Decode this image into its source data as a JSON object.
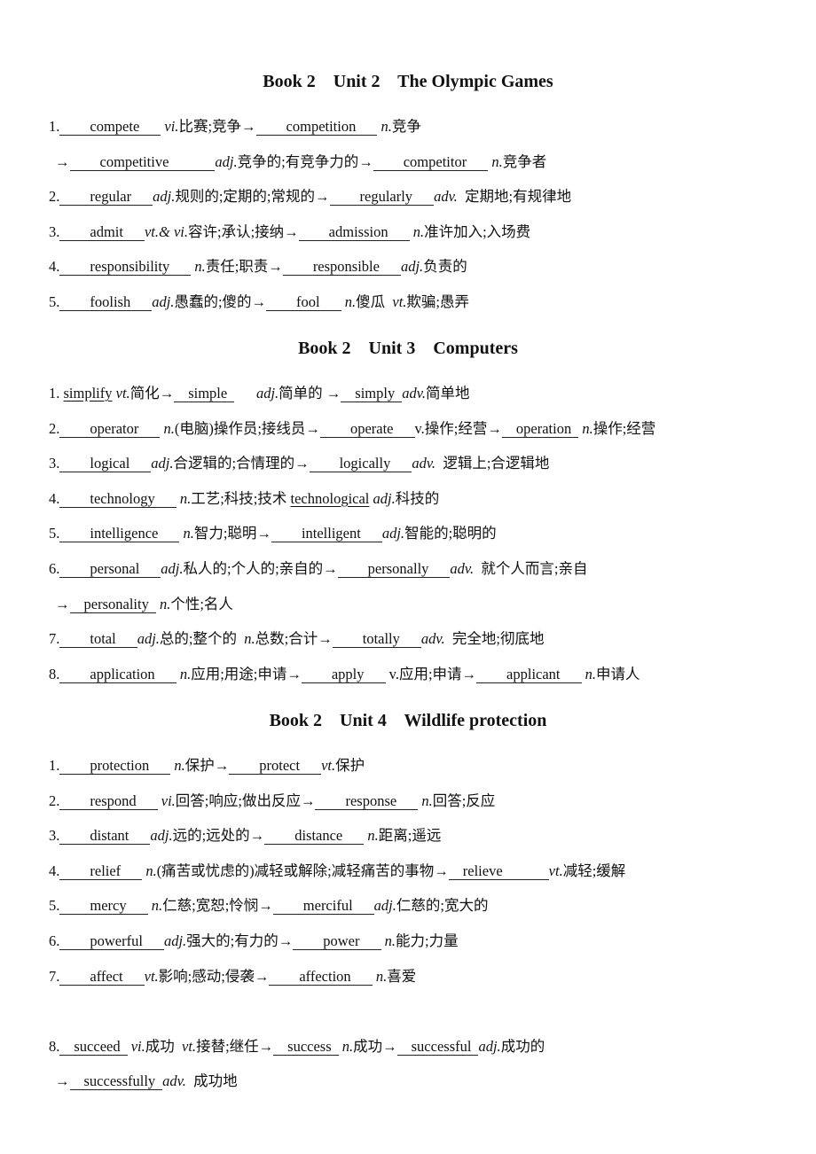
{
  "sections": [
    {
      "title": "Book 2    Unit 2    The Olympic Games",
      "lines": [
        {
          "segs": [
            {
              "t": "text",
              "v": "1."
            },
            {
              "t": "blank",
              "v": "compete"
            },
            {
              "t": "text",
              "v": " "
            },
            {
              "t": "pos",
              "v": "vi."
            },
            {
              "t": "text",
              "v": "比赛;竞争→"
            },
            {
              "t": "blank",
              "v": "competition"
            },
            {
              "t": "text",
              "v": " "
            },
            {
              "t": "pos",
              "v": "n."
            },
            {
              "t": "text",
              "v": "竞争"
            }
          ]
        },
        {
          "indent": true,
          "segs": [
            {
              "t": "text",
              "v": "→"
            },
            {
              "t": "blank",
              "cls": "wide",
              "v": "competitive"
            },
            {
              "t": "pos",
              "v": "adj."
            },
            {
              "t": "text",
              "v": "竞争的;有竞争力的→"
            },
            {
              "t": "blank",
              "v": "competitor"
            },
            {
              "t": "text",
              "v": " "
            },
            {
              "t": "pos",
              "v": "n."
            },
            {
              "t": "text",
              "v": "竞争者"
            }
          ]
        },
        {
          "segs": [
            {
              "t": "text",
              "v": "2."
            },
            {
              "t": "blank",
              "v": "regular"
            },
            {
              "t": "pos",
              "v": "adj."
            },
            {
              "t": "text",
              "v": "规则的;定期的;常规的→"
            },
            {
              "t": "blank",
              "v": "regularly"
            },
            {
              "t": "pos",
              "v": "adv."
            },
            {
              "t": "text",
              "v": "  定期地;有规律地"
            }
          ]
        },
        {
          "segs": [
            {
              "t": "text",
              "v": "3."
            },
            {
              "t": "blank",
              "v": "admit"
            },
            {
              "t": "pos",
              "v": "vt.& vi."
            },
            {
              "t": "text",
              "v": "容许;承认;接纳→"
            },
            {
              "t": "blank",
              "v": "admission"
            },
            {
              "t": "text",
              "v": " "
            },
            {
              "t": "pos",
              "v": "n."
            },
            {
              "t": "text",
              "v": "准许加入;入场费"
            }
          ]
        },
        {
          "segs": [
            {
              "t": "text",
              "v": "4."
            },
            {
              "t": "blank",
              "v": "responsibility"
            },
            {
              "t": "text",
              "v": " "
            },
            {
              "t": "pos",
              "v": "n."
            },
            {
              "t": "text",
              "v": "责任;职责→"
            },
            {
              "t": "blank",
              "v": "responsible"
            },
            {
              "t": "pos",
              "v": "adj."
            },
            {
              "t": "text",
              "v": "负责的"
            }
          ]
        },
        {
          "segs": [
            {
              "t": "text",
              "v": "5."
            },
            {
              "t": "blank",
              "v": "foolish"
            },
            {
              "t": "pos",
              "v": "adj."
            },
            {
              "t": "text",
              "v": "愚蠢的;傻的→"
            },
            {
              "t": "blank",
              "v": "fool"
            },
            {
              "t": "text",
              "v": " "
            },
            {
              "t": "pos",
              "v": "n."
            },
            {
              "t": "text",
              "v": "傻瓜  "
            },
            {
              "t": "pos",
              "v": "vt."
            },
            {
              "t": "text",
              "v": "欺骗;愚弄"
            }
          ]
        }
      ]
    },
    {
      "title": "Book 2    Unit 3    Computers",
      "lines": [
        {
          "segs": [
            {
              "t": "text",
              "v": "1. "
            },
            {
              "t": "u",
              "v": "simplify"
            },
            {
              "t": "text",
              "v": " "
            },
            {
              "t": "pos",
              "v": "vt."
            },
            {
              "t": "text",
              "v": "简化→"
            },
            {
              "t": "blank",
              "cls": "tight",
              "v": "simple"
            },
            {
              "t": "text",
              "v": "      "
            },
            {
              "t": "pos",
              "v": "adj."
            },
            {
              "t": "text",
              "v": "简单的 →"
            },
            {
              "t": "blank",
              "cls": "tight",
              "v": "simply"
            },
            {
              "t": "pos",
              "v": "adv."
            },
            {
              "t": "text",
              "v": "简单地"
            }
          ]
        },
        {
          "segs": [
            {
              "t": "text",
              "v": "2."
            },
            {
              "t": "blank",
              "v": "operator"
            },
            {
              "t": "text",
              "v": " "
            },
            {
              "t": "pos",
              "v": "n."
            },
            {
              "t": "text",
              "v": "(电脑)操作员;接线员→"
            },
            {
              "t": "blank",
              "v": "operate"
            },
            {
              "t": "text",
              "v": "v.操作;经营→"
            },
            {
              "t": "blank",
              "cls": "tight",
              "v": "operation"
            },
            {
              "t": "text",
              "v": " "
            },
            {
              "t": "pos",
              "v": "n."
            },
            {
              "t": "text",
              "v": "操作;经营"
            }
          ]
        },
        {
          "segs": [
            {
              "t": "text",
              "v": "3."
            },
            {
              "t": "blank",
              "v": "logical"
            },
            {
              "t": "pos",
              "v": "adj."
            },
            {
              "t": "text",
              "v": "合逻辑的;合情理的→"
            },
            {
              "t": "blank",
              "v": "logically"
            },
            {
              "t": "pos",
              "v": "adv."
            },
            {
              "t": "text",
              "v": "  逻辑上;合逻辑地"
            }
          ]
        },
        {
          "segs": [
            {
              "t": "text",
              "v": "4."
            },
            {
              "t": "blank",
              "v": "technology"
            },
            {
              "t": "text",
              "v": " "
            },
            {
              "t": "pos",
              "v": "n."
            },
            {
              "t": "text",
              "v": "工艺;科技;技术 "
            },
            {
              "t": "u",
              "v": "technological"
            },
            {
              "t": "text",
              "v": " "
            },
            {
              "t": "pos",
              "v": "adj."
            },
            {
              "t": "text",
              "v": "科技的"
            }
          ]
        },
        {
          "segs": [
            {
              "t": "text",
              "v": "5."
            },
            {
              "t": "blank",
              "v": "intelligence"
            },
            {
              "t": "text",
              "v": " "
            },
            {
              "t": "pos",
              "v": "n."
            },
            {
              "t": "text",
              "v": "智力;聪明→"
            },
            {
              "t": "blank",
              "v": "intelligent"
            },
            {
              "t": "pos",
              "v": "adj."
            },
            {
              "t": "text",
              "v": "智能的;聪明的"
            }
          ]
        },
        {
          "segs": [
            {
              "t": "text",
              "v": "6."
            },
            {
              "t": "blank",
              "v": "personal"
            },
            {
              "t": "pos",
              "v": "adj."
            },
            {
              "t": "text",
              "v": "私人的;个人的;亲自的→"
            },
            {
              "t": "blank",
              "v": "personally"
            },
            {
              "t": "pos",
              "v": "adv."
            },
            {
              "t": "text",
              "v": "  就个人而言;亲自"
            }
          ]
        },
        {
          "indent": true,
          "segs": [
            {
              "t": "text",
              "v": "→"
            },
            {
              "t": "blank",
              "cls": "tight",
              "v": "personality"
            },
            {
              "t": "text",
              "v": " "
            },
            {
              "t": "pos",
              "v": "n."
            },
            {
              "t": "text",
              "v": "个性;名人"
            }
          ]
        },
        {
          "segs": [
            {
              "t": "text",
              "v": "7."
            },
            {
              "t": "blank",
              "v": "total"
            },
            {
              "t": "pos",
              "v": "adj."
            },
            {
              "t": "text",
              "v": "总的;整个的  "
            },
            {
              "t": "pos",
              "v": "n."
            },
            {
              "t": "text",
              "v": "总数;合计→"
            },
            {
              "t": "blank",
              "v": "totally"
            },
            {
              "t": "pos",
              "v": "adv."
            },
            {
              "t": "text",
              "v": "  完全地;彻底地"
            }
          ]
        },
        {
          "segs": [
            {
              "t": "text",
              "v": "8."
            },
            {
              "t": "blank",
              "v": "application"
            },
            {
              "t": "text",
              "v": " "
            },
            {
              "t": "pos",
              "v": "n."
            },
            {
              "t": "text",
              "v": "应用;用途;申请→"
            },
            {
              "t": "blank",
              "v": "apply"
            },
            {
              "t": "text",
              "v": " v.应用;申请→"
            },
            {
              "t": "blank",
              "v": "applicant"
            },
            {
              "t": "text",
              "v": " "
            },
            {
              "t": "pos",
              "v": "n."
            },
            {
              "t": "text",
              "v": "申请人"
            }
          ]
        }
      ]
    },
    {
      "title": "Book 2    Unit 4    Wildlife protection",
      "lines": [
        {
          "segs": [
            {
              "t": "text",
              "v": "1."
            },
            {
              "t": "blank",
              "v": "protection"
            },
            {
              "t": "text",
              "v": " "
            },
            {
              "t": "pos",
              "v": "n."
            },
            {
              "t": "text",
              "v": "保护→"
            },
            {
              "t": "blank",
              "v": "protect"
            },
            {
              "t": "pos",
              "v": "vt."
            },
            {
              "t": "text",
              "v": "保护"
            }
          ]
        },
        {
          "segs": [
            {
              "t": "text",
              "v": "2."
            },
            {
              "t": "blank",
              "v": "respond"
            },
            {
              "t": "text",
              "v": " "
            },
            {
              "t": "pos",
              "v": "vi."
            },
            {
              "t": "text",
              "v": "回答;响应;做出反应→"
            },
            {
              "t": "blank",
              "v": "response"
            },
            {
              "t": "text",
              "v": " "
            },
            {
              "t": "pos",
              "v": "n."
            },
            {
              "t": "text",
              "v": "回答;反应"
            }
          ]
        },
        {
          "segs": [
            {
              "t": "text",
              "v": "3."
            },
            {
              "t": "blank",
              "v": "distant"
            },
            {
              "t": "pos",
              "v": "adj."
            },
            {
              "t": "text",
              "v": "远的;远处的→"
            },
            {
              "t": "blank",
              "v": "distance"
            },
            {
              "t": "text",
              "v": " "
            },
            {
              "t": "pos",
              "v": "n."
            },
            {
              "t": "text",
              "v": "距离;遥远"
            }
          ]
        },
        {
          "segs": [
            {
              "t": "text",
              "v": "4."
            },
            {
              "t": "blank",
              "v": "relief"
            },
            {
              "t": "text",
              "v": " "
            },
            {
              "t": "pos",
              "v": "n."
            },
            {
              "t": "text",
              "v": "(痛苦或忧虑的)减轻或解除;减轻痛苦的事物→"
            },
            {
              "t": "blank",
              "cls": "tight wide",
              "v": "relieve"
            },
            {
              "t": "pos",
              "v": "vt."
            },
            {
              "t": "text",
              "v": "减轻;缓解"
            }
          ]
        },
        {
          "segs": [
            {
              "t": "text",
              "v": "5."
            },
            {
              "t": "blank",
              "v": "mercy"
            },
            {
              "t": "text",
              "v": " "
            },
            {
              "t": "pos",
              "v": "n."
            },
            {
              "t": "text",
              "v": "仁慈;宽恕;怜悯→"
            },
            {
              "t": "blank",
              "v": "merciful"
            },
            {
              "t": "pos",
              "v": "adj."
            },
            {
              "t": "text",
              "v": "仁慈的;宽大的"
            }
          ]
        },
        {
          "segs": [
            {
              "t": "text",
              "v": "6."
            },
            {
              "t": "blank",
              "v": "powerful"
            },
            {
              "t": "pos",
              "v": "adj."
            },
            {
              "t": "text",
              "v": "强大的;有力的→"
            },
            {
              "t": "blank",
              "v": "power"
            },
            {
              "t": "text",
              "v": " "
            },
            {
              "t": "pos",
              "v": "n."
            },
            {
              "t": "text",
              "v": "能力;力量"
            }
          ]
        },
        {
          "segs": [
            {
              "t": "text",
              "v": "7."
            },
            {
              "t": "blank",
              "v": "affect"
            },
            {
              "t": "pos",
              "v": "vt."
            },
            {
              "t": "text",
              "v": "影响;感动;侵袭→"
            },
            {
              "t": "blank",
              "v": "affection"
            },
            {
              "t": "text",
              "v": " "
            },
            {
              "t": "pos",
              "v": "n."
            },
            {
              "t": "text",
              "v": "喜爱"
            }
          ]
        },
        {
          "gap": true,
          "segs": [
            {
              "t": "text",
              "v": "8."
            },
            {
              "t": "blank",
              "cls": "tight",
              "v": "succeed"
            },
            {
              "t": "text",
              "v": " "
            },
            {
              "t": "pos",
              "v": "vi."
            },
            {
              "t": "text",
              "v": "成功  "
            },
            {
              "t": "pos",
              "v": "vt."
            },
            {
              "t": "text",
              "v": "接替;继任→"
            },
            {
              "t": "blank",
              "cls": "tight",
              "v": "success"
            },
            {
              "t": "text",
              "v": " "
            },
            {
              "t": "pos",
              "v": "n."
            },
            {
              "t": "text",
              "v": "成功→"
            },
            {
              "t": "blank",
              "cls": "tight",
              "v": "successful"
            },
            {
              "t": "pos",
              "v": "adj."
            },
            {
              "t": "text",
              "v": "成功的"
            }
          ]
        },
        {
          "indent": true,
          "segs": [
            {
              "t": "text",
              "v": "→"
            },
            {
              "t": "blank",
              "cls": "tight",
              "v": "successfully"
            },
            {
              "t": "pos",
              "v": "adv."
            },
            {
              "t": "text",
              "v": "  成功地"
            }
          ]
        }
      ]
    }
  ]
}
